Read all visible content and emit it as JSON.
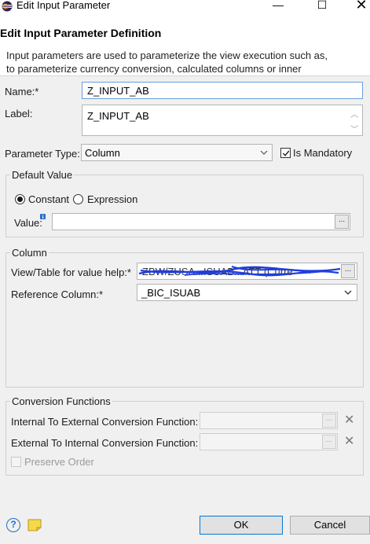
{
  "window": {
    "title": "Edit Input Parameter",
    "minimize_glyph": "—",
    "maximize_glyph": "☐",
    "close_glyph": "✕"
  },
  "header": {
    "title": "Edit Input Parameter Definition",
    "message": "Input parameters are used to parameterize the view execution such as,\nto parameterize currency conversion, calculated columns or inner"
  },
  "form": {
    "name_label": "Name:*",
    "name_value": "Z_INPUT_AB",
    "label_label": "Label:",
    "label_value": "Z_INPUT_AB",
    "param_type_label": "Parameter Type:",
    "param_type_value": "Column",
    "is_mandatory_label": "Is Mandatory",
    "is_mandatory_checked": true
  },
  "default_value": {
    "group_title": "Default Value",
    "constant_label": "Constant",
    "expression_label": "Expression",
    "selected": "constant",
    "value_label": "Value:",
    "value_value": "",
    "browse_label": "..."
  },
  "column": {
    "group_title": "Column",
    "view_table_label": "View/Table for value help:*",
    "view_table_value": "ZBW/ZUSA...ISUAB...ATT (Curre",
    "browse_label": "...",
    "ref_column_label": "Reference Column:*",
    "ref_column_value": "_BIC_ISUAB"
  },
  "conversion": {
    "group_title": "Conversion Functions",
    "int_to_ext_label": "Internal To External Conversion Function:",
    "ext_to_int_label": "External To Internal Conversion Function:",
    "browse_label": "...",
    "clear_glyph": "✕",
    "preserve_order_label": "Preserve Order"
  },
  "footer": {
    "help_glyph": "?",
    "ok_label": "OK",
    "cancel_label": "Cancel"
  },
  "colors": {
    "accent": "#0078d7",
    "redaction_scribble": "#1f3ee0",
    "help_icon": "#1e6fc8",
    "note_icon": "#f5d94a"
  }
}
